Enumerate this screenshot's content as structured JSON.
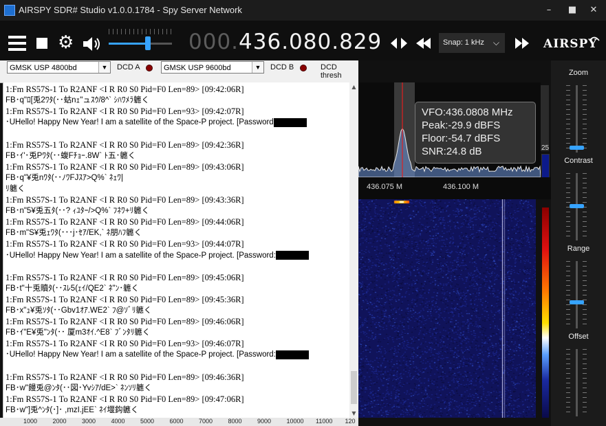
{
  "window": {
    "title": "AIRSPY SDR# Studio v1.0.0.1784 - Spy Server Network",
    "controls": {
      "minimize": "–",
      "maximize": "■",
      "close": "✕"
    }
  },
  "toolbar": {
    "frequency_dim": "000.",
    "frequency_bright": "436.080.829",
    "snap_label": "Snap: 1 kHz",
    "logo_text": "AIRSPY",
    "volume_level": 0.62
  },
  "decoder": {
    "combo_a": "GMSK USP 4800bd",
    "dcd_a_label": "DCD A",
    "combo_b": "GMSK USP 9600bd",
    "dcd_b_label": "DCD B",
    "dcd_thresh_label": "DCD thresh"
  },
  "log": [
    {
      "kind": "hdr",
      "text": "1:Fm RS57S-1 To R2ANF <I R R0 S0 Pid=F0 Len=89> [09:42:06R]"
    },
    {
      "kind": "body",
      "text": "FB･q\"ﾛ[兎2ﾜﾀ(･･蛄nｪ\"ュｽｳ/8^` ｼﾊﾜﾒﾗ軈く"
    },
    {
      "kind": "hdr",
      "text": "1:Fm RS57S-1 To R2ANF <I R R0 S0 Pid=F0 Len=93> [09:42:07R]"
    },
    {
      "kind": "body",
      "text": "･UHello! Happy New Year! I am a satellite of the Space-P project. [Password",
      "redact": true
    },
    {
      "kind": "blank",
      "text": ""
    },
    {
      "kind": "hdr",
      "text": "1:Fm RS57S-1 To R2ANF <I R R0 S0 Pid=F0 Len=89> [09:42:36R]"
    },
    {
      "kind": "body",
      "text": "FB･ｲ'･兎Pﾜﾀ(･･蝮Fﾁｮｰ.8W` ﾄ五･軈く"
    },
    {
      "kind": "hdr",
      "text": "1:Fm RS57S-1 To R2ANF <I R R0 S0 Pid=F0 Len=89> [09:43:06R]"
    },
    {
      "kind": "body",
      "text": "FB･q\"¥兎nﾜﾀ(･･ﾉﾜFJｽｱ>Q%` ﾈｪﾜ|"
    },
    {
      "kind": "body",
      "text": "ﾘ軈く"
    },
    {
      "kind": "hdr",
      "text": "1:Fm RS57S-1 To R2ANF <I R R0 S0 Pid=F0 Len=89> [09:43:36R]"
    },
    {
      "kind": "body",
      "text": "FB･n\"5¥兎五ﾀ(･･?          ｨﾕﾀｰ/>Q%` ﾌﾈﾜ+ﾘ軈く"
    },
    {
      "kind": "hdr",
      "text": "1:Fm RS57S-1 To R2ANF <I R R0 S0 Pid=F0 Len=89> [09:44:06R]"
    },
    {
      "kind": "body",
      "text": "FB･m\"S¥兎ｪﾜﾀ(･･･j･ｾｱ/EK,` ﾈ朋ﾊﾌ軈く"
    },
    {
      "kind": "hdr",
      "text": "1:Fm RS57S-1 To R2ANF <I R R0 S0 Pid=F0 Len=93> [09:44:07R]"
    },
    {
      "kind": "body",
      "text": "･UHello! Happy New Year! I am a satellite of the Space-P project. [Password:",
      "redact": true
    },
    {
      "kind": "blank",
      "text": ""
    },
    {
      "kind": "hdr",
      "text": "1:Fm RS57S-1 To R2ANF <I R R0 S0 Pid=F0 Len=89> [09:45:06R]"
    },
    {
      "kind": "body",
      "text": "FB･t\"十兎贖ﾀ(･･ｽﾚ5(ｪｲ/QE2` ﾈ\"ﾝ･軈く"
    },
    {
      "kind": "hdr",
      "text": "1:Fm RS57S-1 To R2ANF <I R R0 S0 Pid=F0 Len=89> [09:45:36R]"
    },
    {
      "kind": "body",
      "text": "FB･x\"ｭ¥兎ｿﾀ(･･Gbv1ｵｱ.WE2` ﾌ@ｿﾞﾘ軈く"
    },
    {
      "kind": "hdr",
      "text": "1:Fm RS57S-1 To R2ANF <I R R0 S0 Pid=F0 Len=89> [09:46:06R]"
    },
    {
      "kind": "body",
      "text": "FB･ｲ\"E¥兎\"ﾝﾀ(･･ 厦m3ｵｲ.^E8` ﾌﾞﾝﾀﾘ軈く"
    },
    {
      "kind": "hdr",
      "text": "1:Fm RS57S-1 To R2ANF <I R R0 S0 Pid=F0 Len=93> [09:46:07R]"
    },
    {
      "kind": "body",
      "text": "･UHello! Happy New Year! I am a satellite of the Space-P project. [Password:",
      "redact": true
    },
    {
      "kind": "blank",
      "text": ""
    },
    {
      "kind": "hdr",
      "text": "1:Fm RS57S-1 To R2ANF <I R R0 S0 Pid=F0 Len=89> [09:46:36R]"
    },
    {
      "kind": "body",
      "text": "FB･w\"饅兎@ﾝﾀ(･･図･Yvｼｱ/dE>` ﾈﾝｿﾘ軈く"
    },
    {
      "kind": "hdr",
      "text": "1:Fm RS57S-1 To R2ANF <I R R0 S0 Pid=F0 Len=89> [09:47:06R]"
    },
    {
      "kind": "body",
      "text": "FB･w\"]兎^ﾝﾀ(･]･ ,mzI.jEE` ﾈｲ堰鈎軈く"
    }
  ],
  "hz_axis": [
    "1000",
    "2000",
    "3000",
    "4000",
    "5000",
    "6000",
    "7000",
    "8000",
    "9000",
    "10000",
    "11000",
    "120"
  ],
  "spectrum": {
    "vfo": "VFO:436.0808 MHz",
    "peak": "Peak:-29.9 dBFS",
    "floor": "Floor:-54.7 dBFS",
    "snr": "SNR:24.8 dB",
    "scale_value": "25",
    "freq_labels": [
      "436.075 M",
      "436.100 M"
    ]
  },
  "side_panel": {
    "zoom": "Zoom",
    "contrast": "Contrast",
    "range": "Range",
    "offset": "Offset"
  },
  "colors": {
    "accent": "#36a3ff",
    "background": "#111111",
    "led_off": "#8a0000"
  }
}
